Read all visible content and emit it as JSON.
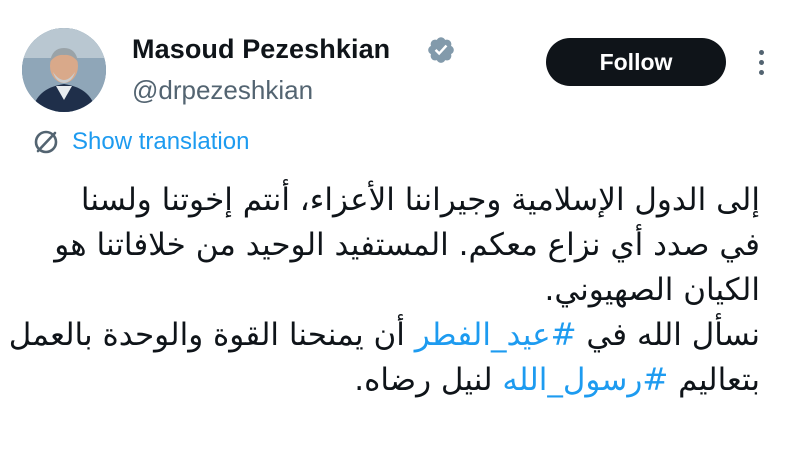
{
  "profile": {
    "display_name": "Masoud Pezeshkian",
    "handle": "@drpezeshkian",
    "verified_icon": "verified-badge-icon",
    "verified_color": "#829aab"
  },
  "actions": {
    "follow_label": "Follow",
    "follow_bg": "#0f1419",
    "more_icon": "more-options-icon"
  },
  "translation": {
    "label": "Show translation",
    "icon": "translate-icon",
    "color": "#1d9bf0"
  },
  "tweet": {
    "line1": "إلى الدول الإسلامية وجيراننا الأعزاء، أنتم إخوتنا ولسنا",
    "line2": "في صدد أي نزاع معكم. المستفيد الوحيد من خلافاتنا هو",
    "line3": "الكيان الصهيوني.",
    "line4_before": "نسأل الله في ",
    "line4_hashtag": "#عيد_الفطر",
    "line4_after": " أن يمنحنا القوة والوحدة بالعمل",
    "line5_before": "بتعاليم ",
    "line5_hashtag": "#رسول_الله",
    "line5_after": " لنيل رضاه."
  }
}
